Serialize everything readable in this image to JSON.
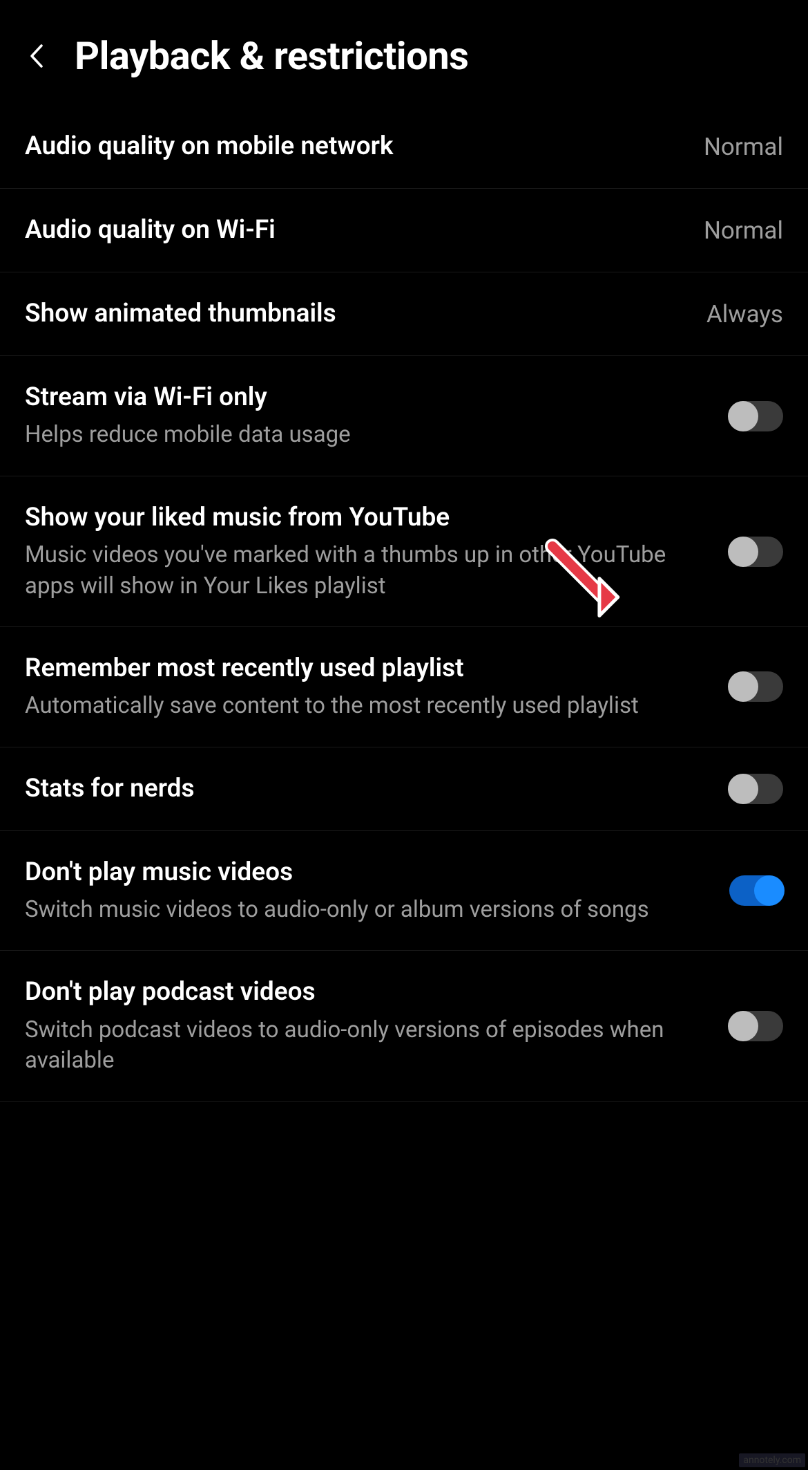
{
  "header": {
    "title": "Playback & restrictions"
  },
  "settings": {
    "audio_mobile": {
      "title": "Audio quality on mobile network",
      "value": "Normal"
    },
    "audio_wifi": {
      "title": "Audio quality on Wi-Fi",
      "value": "Normal"
    },
    "thumbnails": {
      "title": "Show animated thumbnails",
      "value": "Always"
    },
    "stream_wifi": {
      "title": "Stream via Wi-Fi only",
      "subtitle": "Helps reduce mobile data usage",
      "enabled": false
    },
    "liked_music": {
      "title": "Show your liked music from YouTube",
      "subtitle": "Music videos you've marked with a thumbs up in other YouTube apps will show in Your Likes playlist",
      "enabled": false
    },
    "remember_playlist": {
      "title": "Remember most recently used playlist",
      "subtitle": "Automatically save content to the most recently used playlist",
      "enabled": false
    },
    "stats_nerds": {
      "title": "Stats for nerds",
      "enabled": false
    },
    "no_music_videos": {
      "title": "Don't play music videos",
      "subtitle": "Switch music videos to audio-only or album versions of songs",
      "enabled": true
    },
    "no_podcast_videos": {
      "title": "Don't play podcast videos",
      "subtitle": "Switch podcast videos to audio-only versions of episodes when available",
      "enabled": false
    }
  },
  "watermark": "annotely.com"
}
